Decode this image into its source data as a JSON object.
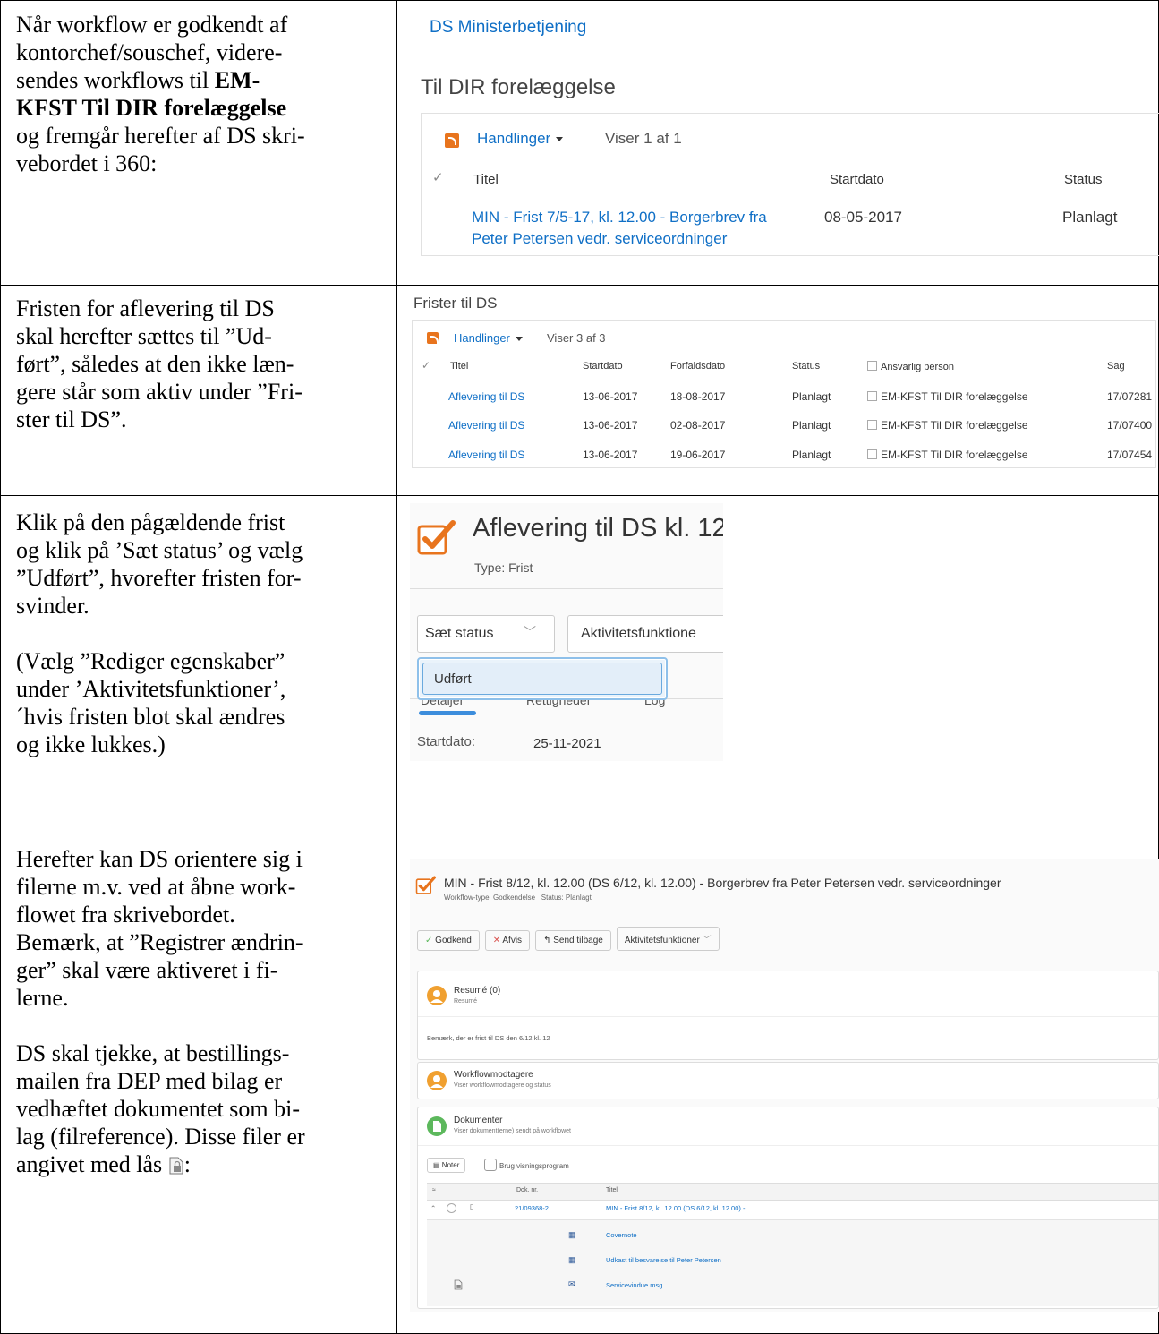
{
  "rows": [
    {
      "text_lines": [
        "Når workflow er godkendt af",
        "kontorchef/souschef, videre-",
        "sendes workflows til ",
        "EM-",
        "KFST Til DIR forelæggelse",
        "og fremgår herefter af DS skri-",
        "vebordet i 360:"
      ]
    },
    {
      "text_lines": [
        "Fristen for aflevering til DS",
        "skal herefter sættes til ”Ud-",
        "ført”, således at den ikke læn-",
        "gere står som aktiv under ”Fri-",
        "ster til DS”."
      ]
    },
    {
      "text_lines": [
        "Klik på den pågældende frist",
        "og klik på ’Sæt status’ og vælg",
        "”Udført”, hvorefter fristen for-",
        "svinder.",
        "(Vælg ”Rediger egenskaber”",
        "under ’Aktivitetsfunktioner’,",
        "´hvis fristen blot skal ændres",
        "og ikke lukkes.)"
      ]
    },
    {
      "text_lines": [
        "Herefter kan DS orientere sig i",
        "filerne m.v. ved at åbne work-",
        "flowet fra skrivebordet.",
        "Bemærk, at ”Registrer ændrin-",
        "ger” skal være aktiveret i fi-",
        "lerne.",
        "DS skal tjekke, at bestillings-",
        "mailen fra DEP med bilag er",
        "vedhæftet dokumentet som bi-",
        "lag (filreference). Disse filer er",
        "angivet med lås ",
        ":"
      ]
    }
  ],
  "shot1": {
    "site": "DS Ministerbetjening",
    "heading": "Til DIR forelæggelse",
    "actions": "Handlinger",
    "count": "Viser 1 af 1",
    "columns": [
      "Titel",
      "Startdato",
      "Status"
    ],
    "row": {
      "title_l1": "MIN - Frist 7/5-17, kl. 12.00 - Borgerbrev fra",
      "title_l2": "Peter Petersen vedr. serviceordninger",
      "start": "08-05-2017",
      "status": "Planlagt"
    }
  },
  "shot2": {
    "heading": "Frister til DS",
    "actions": "Handlinger",
    "count": "Viser 3 af 3",
    "columns": [
      "Titel",
      "Startdato",
      "Forfaldsdato",
      "Status",
      "Ansvarlig person",
      "Sag"
    ],
    "rows": [
      [
        "Aflevering til DS",
        "13-06-2017",
        "18-08-2017",
        "Planlagt",
        "EM-KFST Til DIR forelæggelse",
        "17/07281"
      ],
      [
        "Aflevering til DS",
        "13-06-2017",
        "02-08-2017",
        "Planlagt",
        "EM-KFST Til DIR forelæggelse",
        "17/07400"
      ],
      [
        "Aflevering til DS",
        "13-06-2017",
        "19-06-2017",
        "Planlagt",
        "EM-KFST Til DIR forelæggelse",
        "17/07454"
      ]
    ]
  },
  "shot3": {
    "title": "Aflevering til DS kl. 12",
    "type": "Type: Frist",
    "status_btn": "Sæt status",
    "func_btn": "Aktivitetsfunktione",
    "dropdown_item": "Udført",
    "tabs": [
      "Detaljer",
      "Rettigheder",
      "Log"
    ],
    "start_label": "Startdato:",
    "start_value": "25-11-2021"
  },
  "shot4": {
    "title": "MIN - Frist 8/12, kl. 12.00 (DS 6/12, kl. 12.00) - Borgerbrev fra Peter Petersen vedr. serviceordninger",
    "meta": "Workflow-type: Godkendelse   Status: Planlagt",
    "buttons": [
      "Godkend",
      "Afvis",
      "Send tilbage",
      "Aktivitetsfunktioner"
    ],
    "resume_title": "Resumé (0)",
    "resume_sub": "Resumé",
    "resume_text": "Bemærk, der er frist til DS den 6/12 kl. 12",
    "wf_title": "Workflowmodtagere",
    "wf_sub": "Viser workflowmodtagere og status",
    "doc_title": "Dokumenter",
    "doc_sub": "Viser dokument(erne) sendt på workflowet",
    "notes_btn": "Noter",
    "viewer": "Brug visningsprogram",
    "col_doknr": "Dok. nr.",
    "col_titel": "Titel",
    "doc_nr": "21/09368-2",
    "doc_title_row": "MIN - Frist 8/12, kl. 12.00 (DS 6/12, kl. 12.00) -...",
    "files": [
      "Covernote",
      "Udkast til besvarelse til Peter Petersen",
      "Servicevindue.msg"
    ]
  },
  "colors": {
    "link": "#0f6fc6",
    "orange": "#e8741d",
    "green": "#5cb85c"
  }
}
